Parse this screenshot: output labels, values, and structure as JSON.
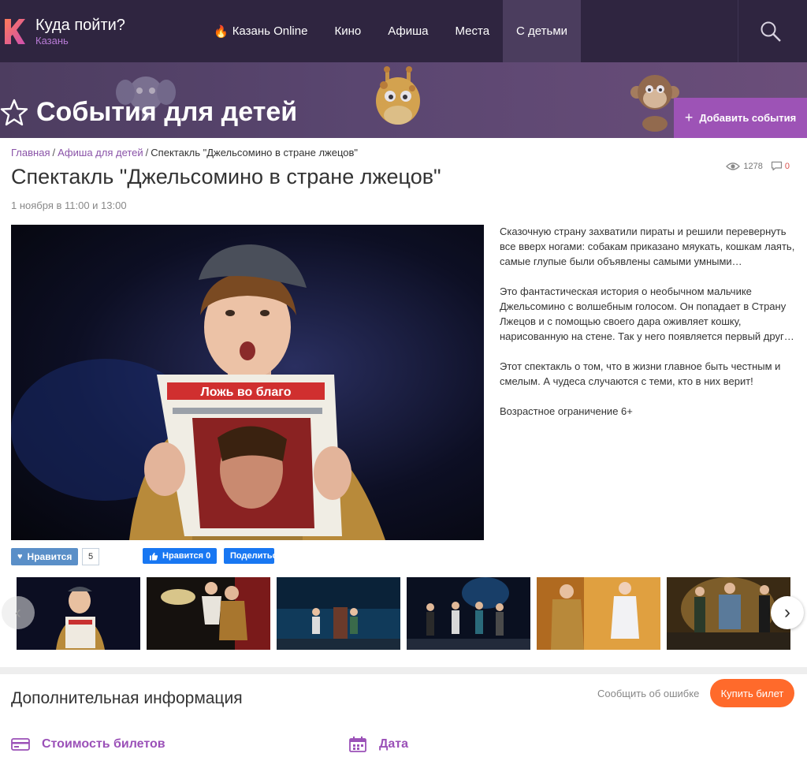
{
  "header": {
    "brand_title": "Куда пойти?",
    "brand_city": "Казань",
    "nav": [
      {
        "label": "Казань Online",
        "icon": "fire-icon"
      },
      {
        "label": "Кино"
      },
      {
        "label": "Афиша"
      },
      {
        "label": "Места"
      },
      {
        "label": "С детьми",
        "active": true
      }
    ]
  },
  "hero": {
    "title": "События для детей",
    "add_button": "Добавить события"
  },
  "breadcrumb": {
    "home": "Главная",
    "section": "Афиша для детей",
    "sep": "/",
    "current": "Спектакль \"Джельсомино в стране лжецов\""
  },
  "event": {
    "title": "Спектакль \"Джельсомино в стране лжецов\"",
    "date": "1 ноября в 11:00 и 13:00",
    "views": "1278",
    "comments": "0",
    "description": [
      "Сказочную страну захватили пираты и решили перевернуть все вверх ногами: собакам приказано мяукать, кошкам лаять, самые глупые были объявлены самыми умными…",
      "Это фантастическая история о необычном мальчике Джельсомино с волшебным голосом. Он попадает в Страну Лжецов и с помощью своего дара оживляет кошку, нарисованную на стене. Так у него появляется первый друг…",
      "Этот спектакль о том, что в жизни главное быть честным и смелым. А чудеса случаются с теми, кто в них верит!",
      "Возрастное ограничение 6+"
    ],
    "poster_text": "Ложь во благо"
  },
  "social": {
    "like_label": "Нравится",
    "like_count": "5",
    "fb_like_label": "Нравится 0",
    "fb_share_label": "Поделиться"
  },
  "gallery": {
    "prev_icon": "chevron-left-icon",
    "next_icon": "chevron-right-icon"
  },
  "info": {
    "heading": "Дополнительная информация",
    "report": "Сообщить об ошибке",
    "buy": "Купить билет",
    "price_label": "Стоимость билетов",
    "date_label": "Дата"
  },
  "colors": {
    "accent": "#9b51b8",
    "buy": "#ff6a2b",
    "nav_bg": "#2f2540",
    "fb": "#1877f2"
  }
}
